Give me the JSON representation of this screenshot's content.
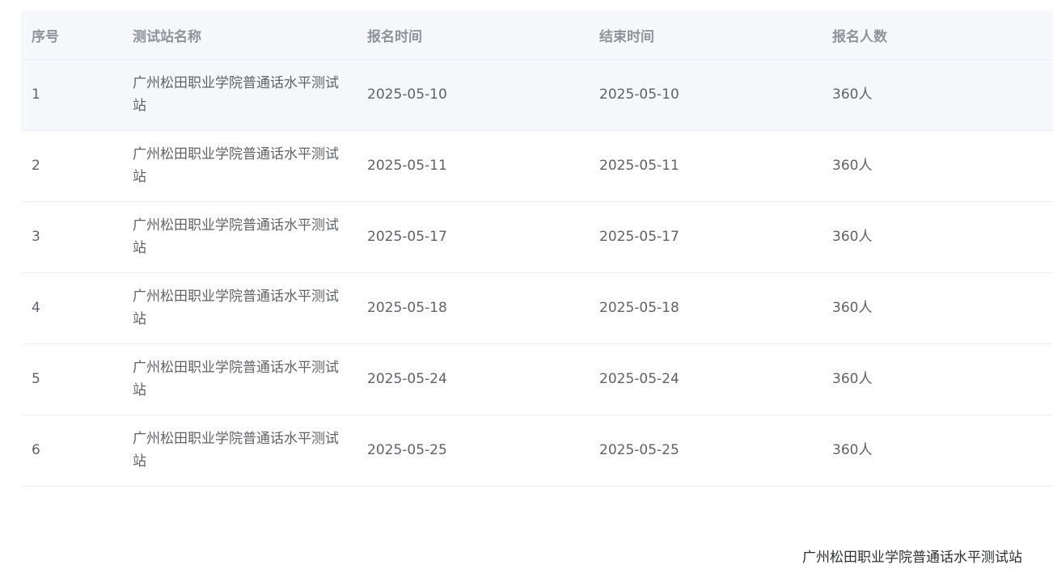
{
  "table": {
    "headers": [
      "序号",
      "测试站名称",
      "报名时间",
      "结束时间",
      "报名人数"
    ],
    "rows": [
      {
        "index": "1",
        "station": "广州松田职业学院普通话水平测试站",
        "start": "2025-05-10",
        "end": "2025-05-10",
        "count": "360人"
      },
      {
        "index": "2",
        "station": "广州松田职业学院普通话水平测试站",
        "start": "2025-05-11",
        "end": "2025-05-11",
        "count": "360人"
      },
      {
        "index": "3",
        "station": "广州松田职业学院普通话水平测试站",
        "start": "2025-05-17",
        "end": "2025-05-17",
        "count": "360人"
      },
      {
        "index": "4",
        "station": "广州松田职业学院普通话水平测试站",
        "start": "2025-05-18",
        "end": "2025-05-18",
        "count": "360人"
      },
      {
        "index": "5",
        "station": "广州松田职业学院普通话水平测试站",
        "start": "2025-05-24",
        "end": "2025-05-24",
        "count": "360人"
      },
      {
        "index": "6",
        "station": "广州松田职业学院普通话水平测试站",
        "start": "2025-05-25",
        "end": "2025-05-25",
        "count": "360人"
      }
    ]
  },
  "footer": {
    "signature": "广州松田职业学院普通话水平测试站"
  },
  "colors": {
    "header_bg": "#f5f7fa",
    "header_text": "#909399",
    "cell_text": "#606266",
    "border": "#ebeef5"
  }
}
